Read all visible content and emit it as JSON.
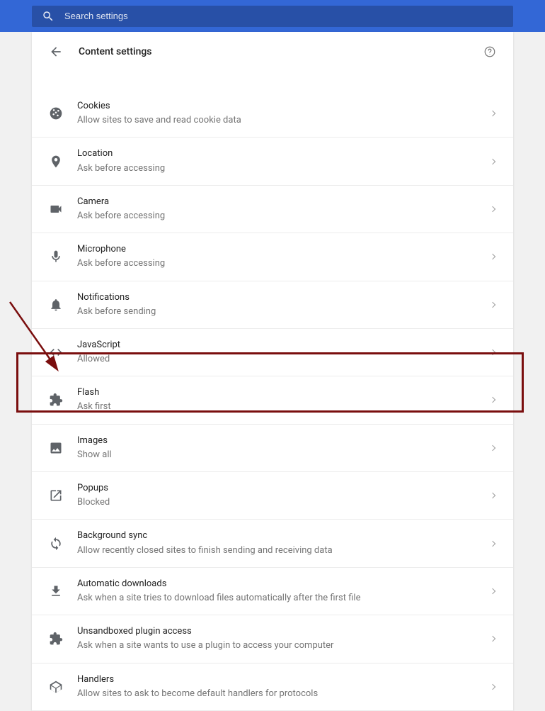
{
  "search": {
    "placeholder": "Search settings"
  },
  "header": {
    "title": "Content settings"
  },
  "rows": [
    {
      "id": "cookies",
      "title": "Cookies",
      "sub": "Allow sites to save and read cookie data"
    },
    {
      "id": "location",
      "title": "Location",
      "sub": "Ask before accessing"
    },
    {
      "id": "camera",
      "title": "Camera",
      "sub": "Ask before accessing"
    },
    {
      "id": "microphone",
      "title": "Microphone",
      "sub": "Ask before accessing"
    },
    {
      "id": "notifications",
      "title": "Notifications",
      "sub": "Ask before sending"
    },
    {
      "id": "javascript",
      "title": "JavaScript",
      "sub": "Allowed"
    },
    {
      "id": "flash",
      "title": "Flash",
      "sub": "Ask first"
    },
    {
      "id": "images",
      "title": "Images",
      "sub": "Show all"
    },
    {
      "id": "popups",
      "title": "Popups",
      "sub": "Blocked"
    },
    {
      "id": "bgsync",
      "title": "Background sync",
      "sub": "Allow recently closed sites to finish sending and receiving data"
    },
    {
      "id": "autodl",
      "title": "Automatic downloads",
      "sub": "Ask when a site tries to download files automatically after the first file"
    },
    {
      "id": "unsandboxed",
      "title": "Unsandboxed plugin access",
      "sub": "Ask when a site wants to use a plugin to access your computer"
    },
    {
      "id": "handlers",
      "title": "Handlers",
      "sub": "Allow sites to ask to become default handlers for protocols"
    }
  ],
  "annotation": {
    "highlight_row_id": "flash"
  }
}
